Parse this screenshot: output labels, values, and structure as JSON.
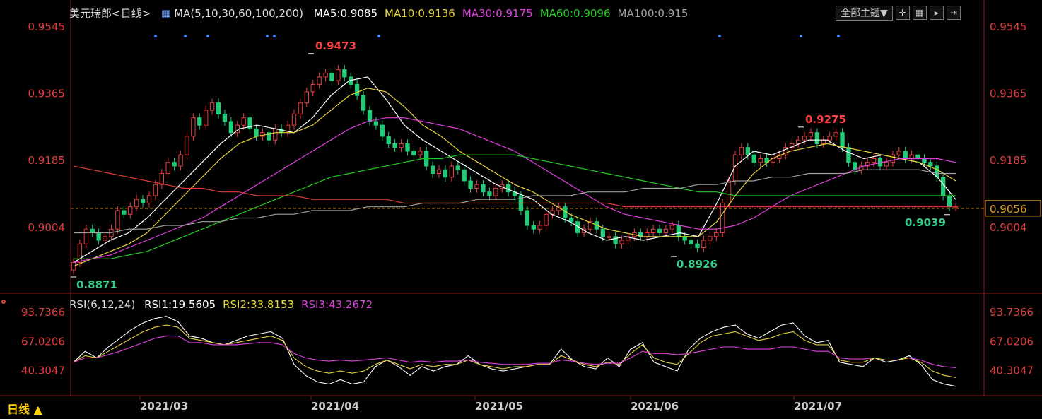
{
  "instrument": "美元瑞郎<日线>",
  "ma_label": "MA(5,10,30,60,100,200)",
  "ma_values": [
    {
      "text": "MA5:0.9085",
      "color": "#ffffff"
    },
    {
      "text": "MA10:0.9136",
      "color": "#e6d33c"
    },
    {
      "text": "MA30:0.9175",
      "color": "#e040e0"
    },
    {
      "text": "MA60:0.9096",
      "color": "#22cc22"
    },
    {
      "text": "MA100:0.915",
      "color": "#a0a0a0"
    }
  ],
  "theme_button": "全部主题▼",
  "icon_buttons": [
    "crosshair-icon",
    "grid-icon",
    "play-icon",
    "next-icon"
  ],
  "period_button": "日线 ▲",
  "current_price": "0.9056",
  "rsi_label": "RSI(6,12,24)",
  "rsi_values": [
    {
      "text": "RSI1:19.5605",
      "color": "#ffffff"
    },
    {
      "text": "RSI2:33.8153",
      "color": "#e6d33c"
    },
    {
      "text": "RSI3:43.2672",
      "color": "#e040e0"
    }
  ],
  "chart_data": {
    "type": "candlestick",
    "y_ticks": [
      "0.9545",
      "0.9365",
      "0.9185",
      "0.9004"
    ],
    "ylim": [
      0.8871,
      0.9545
    ],
    "x_ticks": [
      "2021/03",
      "2021/04",
      "2021/05",
      "2021/06",
      "2021/07"
    ],
    "annotations": [
      {
        "text": "0.9473",
        "value": 0.9473,
        "kind": "high"
      },
      {
        "text": "0.9275",
        "value": 0.9275,
        "kind": "high"
      },
      {
        "text": "0.8871",
        "value": 0.8871,
        "kind": "low"
      },
      {
        "text": "0.8926",
        "value": 0.8926,
        "kind": "low"
      },
      {
        "text": "0.9039",
        "value": 0.9039,
        "kind": "low"
      }
    ],
    "candles_close": [
      0.891,
      0.896,
      0.9,
      0.899,
      0.897,
      0.898,
      0.9,
      0.905,
      0.904,
      0.906,
      0.908,
      0.907,
      0.909,
      0.912,
      0.915,
      0.918,
      0.917,
      0.92,
      0.925,
      0.93,
      0.928,
      0.932,
      0.934,
      0.931,
      0.929,
      0.926,
      0.928,
      0.93,
      0.927,
      0.925,
      0.926,
      0.924,
      0.927,
      0.926,
      0.928,
      0.931,
      0.934,
      0.937,
      0.939,
      0.941,
      0.942,
      0.94,
      0.943,
      0.941,
      0.939,
      0.936,
      0.932,
      0.929,
      0.928,
      0.925,
      0.923,
      0.922,
      0.923,
      0.921,
      0.92,
      0.921,
      0.917,
      0.915,
      0.916,
      0.914,
      0.917,
      0.916,
      0.913,
      0.911,
      0.912,
      0.91,
      0.909,
      0.911,
      0.912,
      0.91,
      0.909,
      0.905,
      0.901,
      0.9,
      0.901,
      0.904,
      0.905,
      0.906,
      0.903,
      0.902,
      0.899,
      0.9,
      0.902,
      0.9,
      0.898,
      0.898,
      0.896,
      0.897,
      0.898,
      0.899,
      0.898,
      0.899,
      0.9,
      0.899,
      0.9,
      0.901,
      0.898,
      0.897,
      0.896,
      0.895,
      0.897,
      0.898,
      0.899,
      0.907,
      0.913,
      0.92,
      0.922,
      0.92,
      0.918,
      0.919,
      0.918,
      0.919,
      0.92,
      0.922,
      0.923,
      0.924,
      0.925,
      0.926,
      0.923,
      0.924,
      0.925,
      0.926,
      0.922,
      0.918,
      0.916,
      0.917,
      0.918,
      0.919,
      0.917,
      0.918,
      0.92,
      0.921,
      0.919,
      0.92,
      0.919,
      0.918,
      0.917,
      0.914,
      0.909,
      0.906,
      0.906
    ],
    "series": [
      {
        "name": "MA5",
        "color": "#ffffff",
        "values": [
          0.891,
          0.894,
          0.897,
          0.899,
          0.903,
          0.908,
          0.913,
          0.918,
          0.923,
          0.927,
          0.928,
          0.927,
          0.926,
          0.93,
          0.936,
          0.94,
          0.941,
          0.935,
          0.928,
          0.924,
          0.921,
          0.918,
          0.915,
          0.912,
          0.91,
          0.908,
          0.904,
          0.902,
          0.899,
          0.897,
          0.898,
          0.897,
          0.898,
          0.899,
          0.898,
          0.907,
          0.917,
          0.921,
          0.92,
          0.922,
          0.924,
          0.924,
          0.921,
          0.919,
          0.92,
          0.919,
          0.918,
          0.914,
          0.908
        ]
      },
      {
        "name": "MA10",
        "color": "#e6d33c",
        "values": [
          0.89,
          0.892,
          0.894,
          0.896,
          0.899,
          0.904,
          0.909,
          0.914,
          0.919,
          0.923,
          0.925,
          0.926,
          0.926,
          0.928,
          0.932,
          0.936,
          0.938,
          0.937,
          0.933,
          0.928,
          0.925,
          0.921,
          0.918,
          0.915,
          0.912,
          0.91,
          0.907,
          0.904,
          0.902,
          0.9,
          0.899,
          0.898,
          0.898,
          0.898,
          0.898,
          0.902,
          0.909,
          0.915,
          0.919,
          0.921,
          0.922,
          0.923,
          0.922,
          0.921,
          0.92,
          0.919,
          0.918,
          0.916,
          0.913
        ]
      },
      {
        "name": "MA30",
        "color": "#e040e0",
        "values": [
          0.891,
          0.892,
          0.893,
          0.895,
          0.897,
          0.899,
          0.901,
          0.903,
          0.906,
          0.909,
          0.912,
          0.915,
          0.918,
          0.921,
          0.924,
          0.927,
          0.929,
          0.93,
          0.93,
          0.929,
          0.928,
          0.927,
          0.925,
          0.923,
          0.921,
          0.918,
          0.915,
          0.912,
          0.909,
          0.906,
          0.904,
          0.903,
          0.902,
          0.901,
          0.9,
          0.9,
          0.901,
          0.903,
          0.906,
          0.909,
          0.911,
          0.913,
          0.915,
          0.917,
          0.918,
          0.919,
          0.919,
          0.919,
          0.918
        ]
      },
      {
        "name": "MA60",
        "color": "#22cc22",
        "values": [
          0.892,
          0.892,
          0.892,
          0.893,
          0.894,
          0.896,
          0.898,
          0.9,
          0.902,
          0.904,
          0.906,
          0.908,
          0.91,
          0.912,
          0.914,
          0.915,
          0.916,
          0.917,
          0.918,
          0.919,
          0.919,
          0.92,
          0.92,
          0.92,
          0.92,
          0.919,
          0.918,
          0.917,
          0.916,
          0.915,
          0.914,
          0.913,
          0.912,
          0.911,
          0.91,
          0.91,
          0.909,
          0.909,
          0.909,
          0.909,
          0.909,
          0.909,
          0.909,
          0.909,
          0.909,
          0.909,
          0.909,
          0.909,
          0.909
        ]
      },
      {
        "name": "MA100",
        "color": "#a0a0a0",
        "values": [
          0.899,
          0.899,
          0.899,
          0.9,
          0.9,
          0.901,
          0.901,
          0.902,
          0.902,
          0.903,
          0.903,
          0.904,
          0.904,
          0.905,
          0.905,
          0.905,
          0.906,
          0.906,
          0.906,
          0.907,
          0.907,
          0.907,
          0.908,
          0.908,
          0.908,
          0.909,
          0.909,
          0.909,
          0.91,
          0.91,
          0.91,
          0.911,
          0.911,
          0.911,
          0.912,
          0.912,
          0.913,
          0.913,
          0.914,
          0.914,
          0.915,
          0.915,
          0.915,
          0.916,
          0.916,
          0.916,
          0.916,
          0.915,
          0.915
        ]
      },
      {
        "name": "MA200",
        "color": "#e03c3c",
        "values": [
          0.917,
          0.916,
          0.915,
          0.914,
          0.913,
          0.912,
          0.911,
          0.911,
          0.91,
          0.91,
          0.909,
          0.909,
          0.909,
          0.908,
          0.908,
          0.908,
          0.908,
          0.908,
          0.907,
          0.907,
          0.907,
          0.907,
          0.907,
          0.907,
          0.907,
          0.907,
          0.907,
          0.907,
          0.907,
          0.907,
          0.906,
          0.906,
          0.906,
          0.906,
          0.906,
          0.906,
          0.906,
          0.906,
          0.906,
          0.906,
          0.906,
          0.906,
          0.906,
          0.906,
          0.906,
          0.906,
          0.906,
          0.906,
          0.906
        ]
      }
    ],
    "rsi": {
      "y_ticks": [
        "93.7366",
        "67.0206",
        "40.3047"
      ],
      "ylim": [
        20,
        95
      ],
      "series": [
        {
          "name": "RSI1",
          "color": "#ffffff",
          "values": [
            48,
            58,
            52,
            62,
            70,
            78,
            84,
            88,
            90,
            85,
            72,
            70,
            66,
            64,
            68,
            72,
            74,
            76,
            70,
            46,
            36,
            30,
            28,
            32,
            28,
            30,
            44,
            50,
            44,
            36,
            44,
            40,
            44,
            46,
            54,
            46,
            42,
            40,
            42,
            44,
            46,
            46,
            60,
            50,
            44,
            42,
            52,
            44,
            60,
            66,
            48,
            44,
            40,
            60,
            70,
            76,
            80,
            82,
            74,
            70,
            76,
            82,
            84,
            72,
            66,
            68,
            48,
            46,
            44,
            52,
            48,
            50,
            54,
            46,
            32,
            28,
            26
          ]
        },
        {
          "name": "RSI2",
          "color": "#e6d33c",
          "values": [
            48,
            54,
            52,
            58,
            64,
            70,
            76,
            80,
            82,
            80,
            70,
            68,
            66,
            64,
            66,
            68,
            70,
            72,
            68,
            52,
            44,
            40,
            38,
            40,
            38,
            40,
            46,
            50,
            46,
            42,
            46,
            44,
            46,
            46,
            50,
            46,
            44,
            42,
            44,
            44,
            46,
            46,
            54,
            50,
            46,
            44,
            48,
            46,
            56,
            64,
            52,
            48,
            46,
            56,
            66,
            72,
            74,
            76,
            72,
            68,
            70,
            74,
            76,
            68,
            64,
            64,
            50,
            48,
            48,
            52,
            50,
            50,
            52,
            48,
            40,
            36,
            34
          ]
        },
        {
          "name": "RSI3",
          "color": "#e040e0",
          "values": [
            48,
            52,
            52,
            55,
            58,
            62,
            66,
            70,
            72,
            72,
            66,
            66,
            64,
            64,
            64,
            65,
            66,
            66,
            64,
            56,
            52,
            50,
            49,
            50,
            49,
            50,
            51,
            52,
            50,
            48,
            49,
            48,
            49,
            49,
            50,
            48,
            47,
            46,
            46,
            46,
            47,
            47,
            50,
            49,
            47,
            46,
            47,
            47,
            52,
            58,
            56,
            56,
            55,
            56,
            58,
            60,
            62,
            62,
            60,
            60,
            60,
            62,
            62,
            60,
            58,
            58,
            52,
            51,
            51,
            52,
            52,
            52,
            52,
            50,
            46,
            44,
            43
          ]
        }
      ]
    }
  }
}
